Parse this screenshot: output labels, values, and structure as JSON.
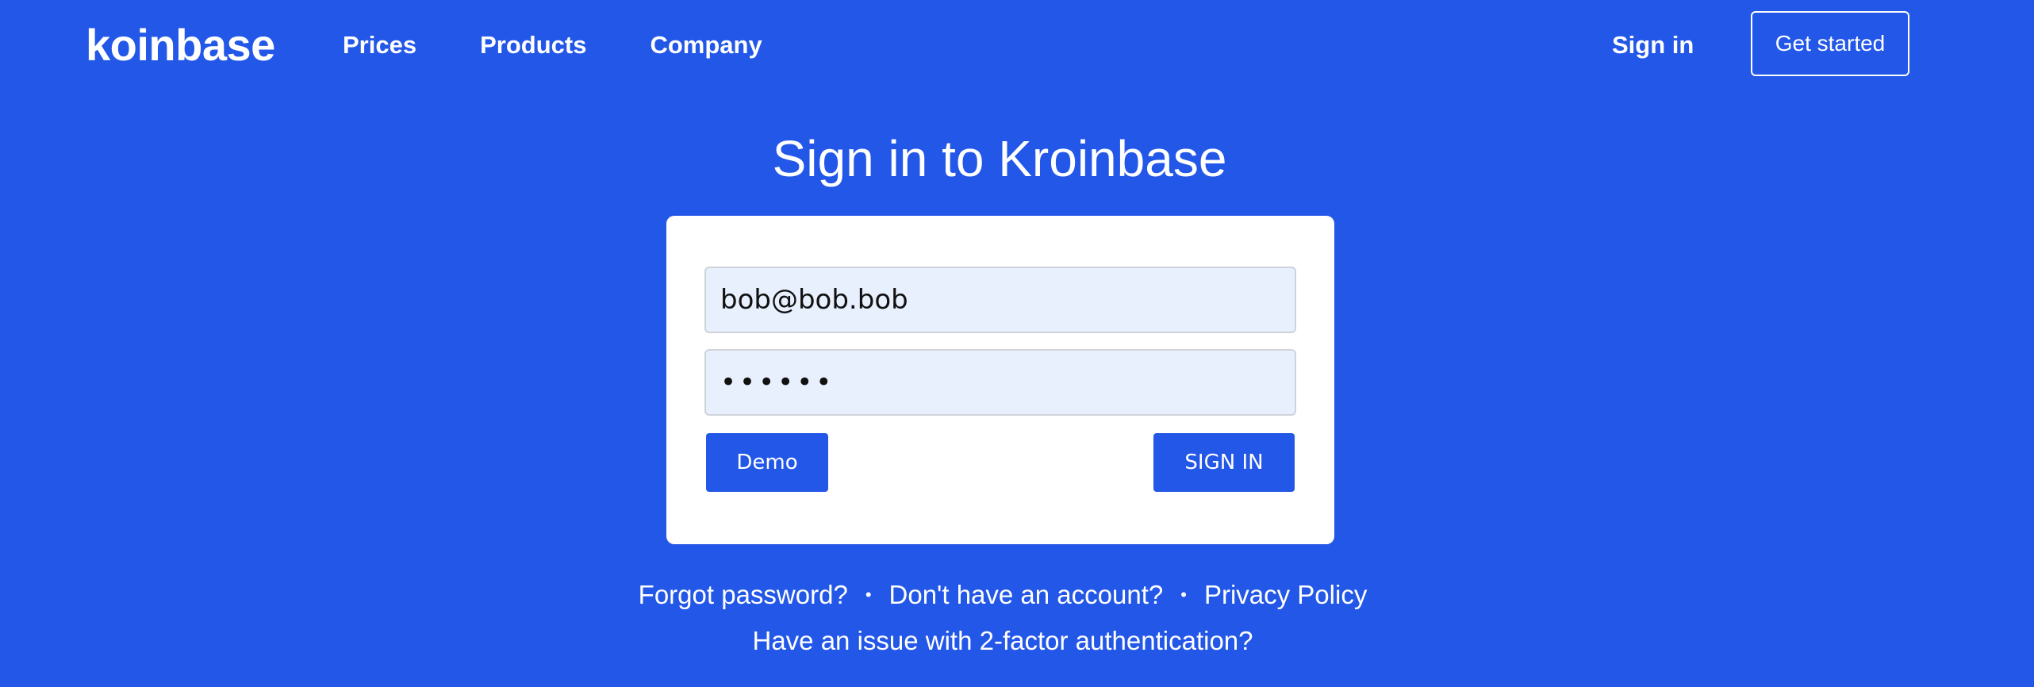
{
  "header": {
    "logo": "koinbase",
    "nav": [
      "Prices",
      "Products",
      "Company"
    ],
    "signin_label": "Sign in",
    "get_started_label": "Get started"
  },
  "main": {
    "title": "Sign in to Kroinbase",
    "form": {
      "email_value": "bob@bob.bob",
      "password_value": "••••••",
      "demo_label": "Demo",
      "signin_label": "SIGN IN"
    },
    "links": {
      "forgot": "Forgot password?",
      "no_account": "Don't have an account?",
      "privacy": "Privacy Policy",
      "separator": "•",
      "two_factor": "Have an issue with 2-factor authentication?"
    }
  },
  "colors": {
    "background": "#2357e8",
    "button": "#2357e8",
    "input_background": "#e8effd"
  }
}
